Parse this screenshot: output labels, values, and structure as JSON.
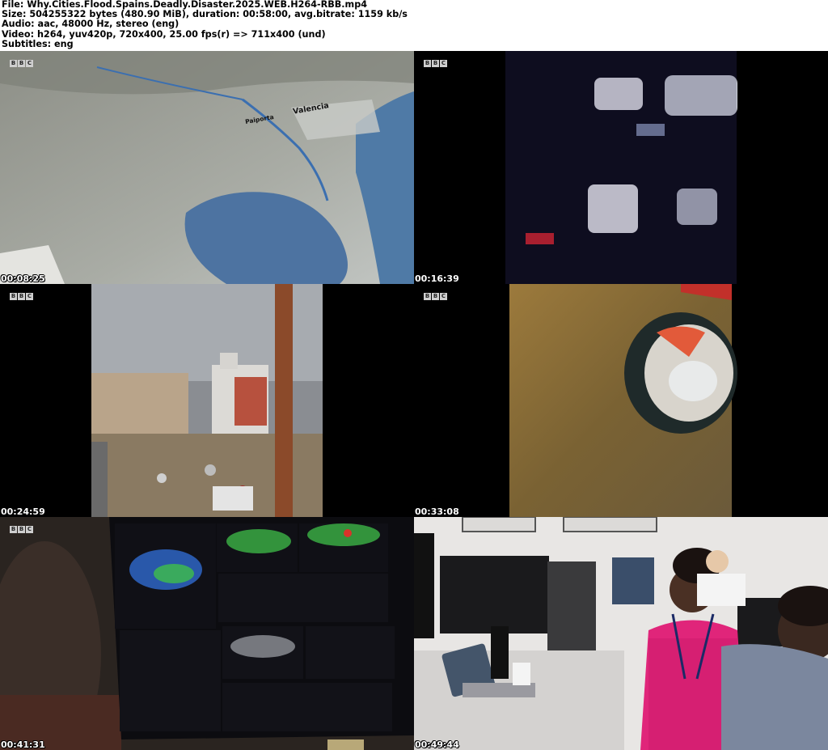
{
  "header": {
    "line1": "File: Why.Cities.Flood.Spains.Deadly.Disaster.2025.WEB.H264-RBB.mp4",
    "line2": "Size: 504255322 bytes (480.90 MiB), duration: 00:58:00, avg.bitrate: 1159 kb/s",
    "line3": "Audio: aac, 48000 Hz, stereo (eng)",
    "line4": "Video: h264, yuv420p, 720x400, 25.00 fps(r) => 711x400 (und)",
    "line5": "Subtitles: eng"
  },
  "logo_letters": [
    "B",
    "B",
    "C"
  ],
  "thumbnails": [
    {
      "timestamp": "00:08:25",
      "map_labels": [
        "Valencia",
        "Paiporta"
      ]
    },
    {
      "timestamp": "00:16:39"
    },
    {
      "timestamp": "00:24:59"
    },
    {
      "timestamp": "00:33:08"
    },
    {
      "timestamp": "00:41:31"
    },
    {
      "timestamp": "00:49:44"
    }
  ]
}
